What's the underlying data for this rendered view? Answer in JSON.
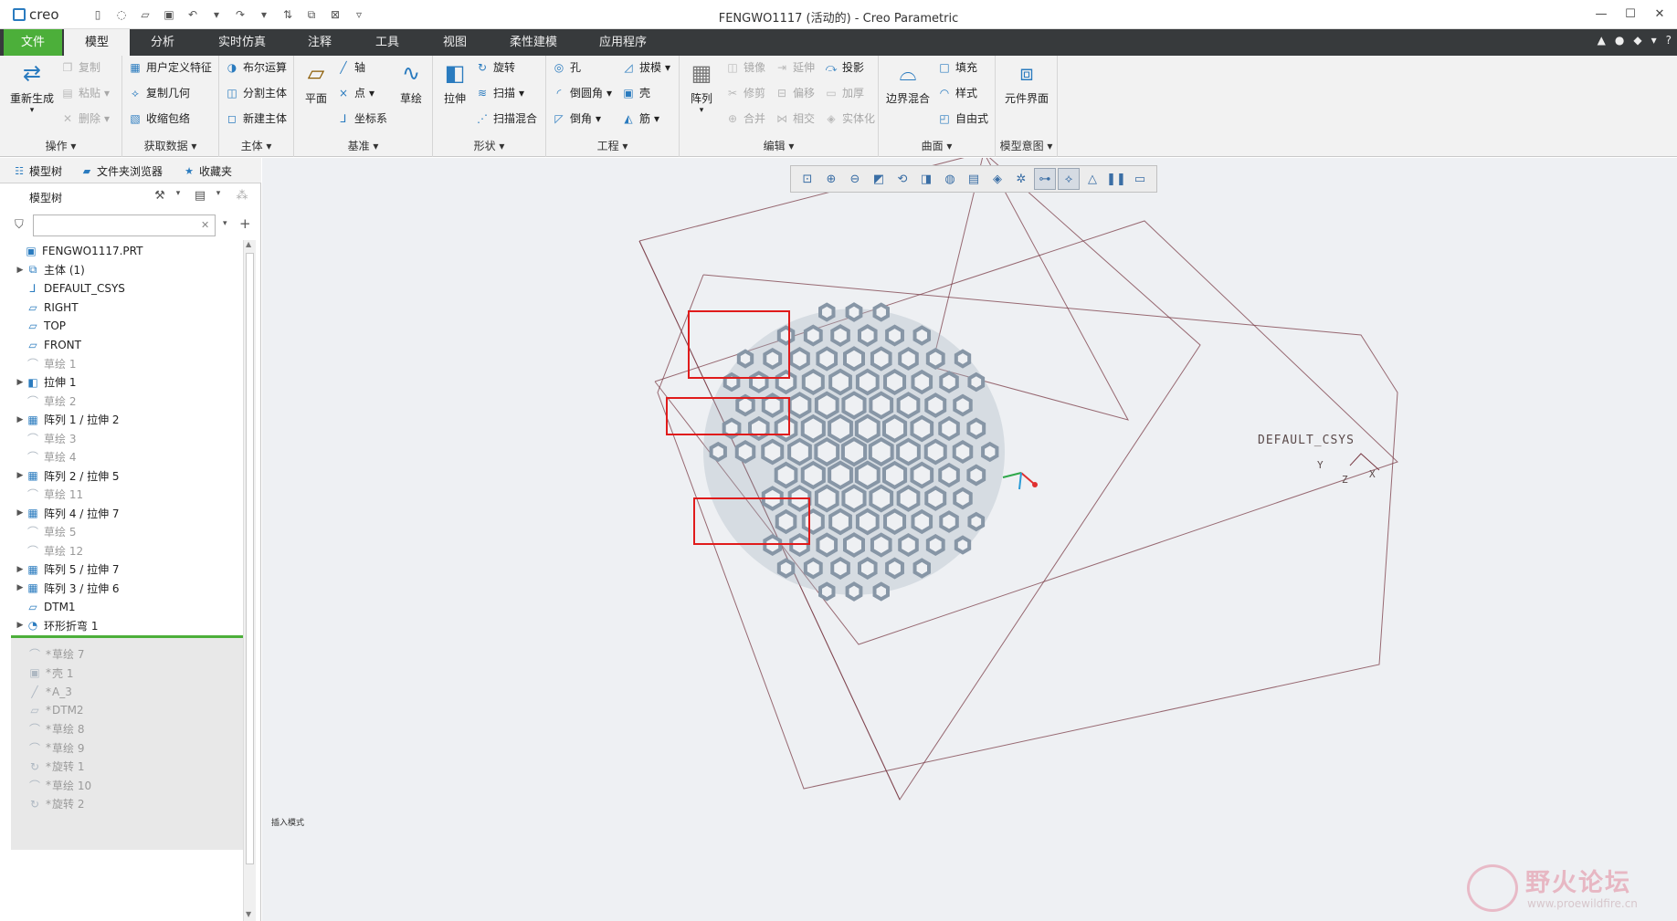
{
  "app": {
    "logo_text": "creo",
    "window_title": "FENGWO1117 (活动的) - Creo Parametric"
  },
  "window_controls": {
    "minimize": "—",
    "maximize": "☐",
    "close": "✕"
  },
  "tabs": [
    {
      "label": "文件"
    },
    {
      "label": "模型"
    },
    {
      "label": "分析"
    },
    {
      "label": "实时仿真"
    },
    {
      "label": "注释"
    },
    {
      "label": "工具"
    },
    {
      "label": "视图"
    },
    {
      "label": "柔性建模"
    },
    {
      "label": "应用程序"
    }
  ],
  "ribbon": {
    "groups": {
      "operations": {
        "label": "操作",
        "regenerate": "重新生成",
        "copy": "复制",
        "paste": "粘贴",
        "delete": "删除"
      },
      "get_data": {
        "label": "获取数据",
        "udf": "用户定义特征",
        "copy_geom": "复制几何",
        "shrinkwrap": "收缩包络"
      },
      "body": {
        "label": "主体",
        "boolean": "布尔运算",
        "split": "分割主体",
        "new_body": "新建主体"
      },
      "datum": {
        "label": "基准",
        "plane": "平面",
        "axis": "轴",
        "point": "点",
        "csys": "坐标系",
        "sketch": "草绘"
      },
      "shapes": {
        "label": "形状",
        "extrude": "拉伸",
        "revolve": "旋转",
        "sweep": "扫描",
        "swept_blend": "扫描混合"
      },
      "engineering": {
        "label": "工程",
        "hole": "孔",
        "round": "倒圆角",
        "chamfer": "倒角",
        "draft": "拔模",
        "shell": "壳",
        "rib": "筋"
      },
      "editing": {
        "label": "编辑",
        "pattern": "阵列",
        "mirror": "镜像",
        "extend": "延伸",
        "project": "投影",
        "trim": "修剪",
        "offset": "偏移",
        "thicken": "加厚",
        "merge": "合并",
        "intersect": "相交",
        "solidify": "实体化"
      },
      "surfaces": {
        "label": "曲面",
        "boundary_blend": "边界混合",
        "fill": "填充",
        "style": "样式",
        "freestyle": "自由式"
      },
      "model_intent": {
        "label": "模型意图",
        "component_interface": "元件界面"
      }
    }
  },
  "left_panel": {
    "nav_tabs": [
      "模型树",
      "文件夹浏览器",
      "收藏夹"
    ],
    "tree_title": "模型树",
    "filter_placeholder": "",
    "tree_items": [
      {
        "label": "FENGWO1117.PRT",
        "icon": "part-icon",
        "expand": "",
        "dim": false,
        "indent": 0
      },
      {
        "label": "主体 (1)",
        "icon": "body-icon",
        "expand": "▶",
        "dim": false,
        "indent": 1
      },
      {
        "label": "DEFAULT_CSYS",
        "icon": "csys-icon",
        "expand": "",
        "dim": false,
        "indent": 1
      },
      {
        "label": "RIGHT",
        "icon": "datum-plane-icon",
        "expand": "",
        "dim": false,
        "indent": 1
      },
      {
        "label": "TOP",
        "icon": "datum-plane-icon",
        "expand": "",
        "dim": false,
        "indent": 1
      },
      {
        "label": "FRONT",
        "icon": "datum-plane-icon",
        "expand": "",
        "dim": false,
        "indent": 1
      },
      {
        "label": "草绘 1",
        "icon": "sketch-icon",
        "expand": "",
        "dim": true,
        "indent": 1
      },
      {
        "label": "拉伸 1",
        "icon": "extrude-icon",
        "expand": "▶",
        "dim": false,
        "indent": 1
      },
      {
        "label": "草绘 2",
        "icon": "sketch-icon",
        "expand": "",
        "dim": true,
        "indent": 1
      },
      {
        "label": "阵列 1 / 拉伸 2",
        "icon": "pattern-icon",
        "expand": "▶",
        "dim": false,
        "indent": 1
      },
      {
        "label": "草绘 3",
        "icon": "sketch-icon",
        "expand": "",
        "dim": true,
        "indent": 1
      },
      {
        "label": "草绘 4",
        "icon": "sketch-icon",
        "expand": "",
        "dim": true,
        "indent": 1
      },
      {
        "label": "阵列 2 / 拉伸 5",
        "icon": "pattern-icon",
        "expand": "▶",
        "dim": false,
        "indent": 1
      },
      {
        "label": "草绘 11",
        "icon": "sketch-icon",
        "expand": "",
        "dim": true,
        "indent": 1
      },
      {
        "label": "阵列 4 / 拉伸 7",
        "icon": "pattern-icon",
        "expand": "▶",
        "dim": false,
        "indent": 1
      },
      {
        "label": "草绘 5",
        "icon": "sketch-icon",
        "expand": "",
        "dim": true,
        "indent": 1
      },
      {
        "label": "草绘 12",
        "icon": "sketch-icon",
        "expand": "",
        "dim": true,
        "indent": 1
      },
      {
        "label": "阵列 5 / 拉伸 7",
        "icon": "pattern-icon",
        "expand": "▶",
        "dim": false,
        "indent": 1
      },
      {
        "label": "阵列 3 / 拉伸 6",
        "icon": "pattern-icon",
        "expand": "▶",
        "dim": false,
        "indent": 1
      },
      {
        "label": "DTM1",
        "icon": "datum-plane-icon",
        "expand": "",
        "dim": false,
        "indent": 1
      },
      {
        "label": "环形折弯 1",
        "icon": "toroidal-bend-icon",
        "expand": "▶",
        "dim": false,
        "indent": 1
      }
    ],
    "after_insert_items": [
      {
        "label": "草绘 7",
        "icon": "sketch-icon"
      },
      {
        "label": "壳 1",
        "icon": "shell-icon"
      },
      {
        "label": "A_3",
        "icon": "axis-icon"
      },
      {
        "label": "DTM2",
        "icon": "datum-plane-icon"
      },
      {
        "label": "草绘 8",
        "icon": "sketch-icon"
      },
      {
        "label": "草绘 9",
        "icon": "sketch-icon"
      },
      {
        "label": "旋转 1",
        "icon": "revolve-icon"
      },
      {
        "label": "草绘 10",
        "icon": "sketch-icon"
      },
      {
        "label": "旋转 2",
        "icon": "revolve-icon"
      }
    ]
  },
  "graphics": {
    "mode_text": "插入模式",
    "csys_label": "DEFAULT_CSYS",
    "axis_labels": {
      "y": "Y",
      "z": "Z",
      "x": "X"
    },
    "watermark": {
      "title": "野火论坛",
      "url": "www.proewildfire.cn"
    },
    "highlight_color": "#e01b1b",
    "model_color": "#a9b6c4",
    "datum_color": "#7a3b45"
  },
  "colors": {
    "file_tab": "#4caf3a",
    "tab_bar": "#373a3c",
    "ribbon_bg": "#f2f2f2",
    "accent": "#2a7bbf"
  }
}
